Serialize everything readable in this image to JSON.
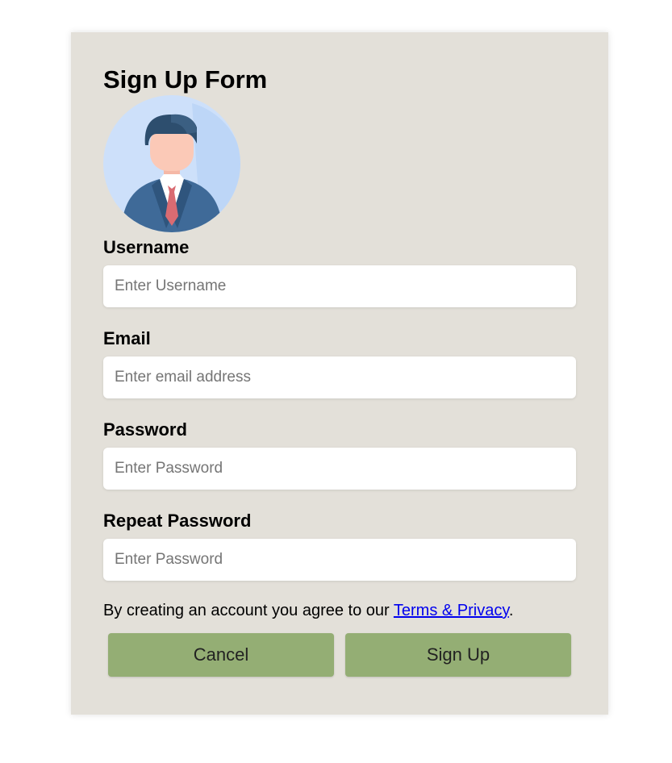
{
  "form": {
    "title": "Sign Up Form",
    "avatar_icon": "user-avatar-icon",
    "fields": [
      {
        "label": "Username",
        "placeholder": "Enter Username",
        "value": ""
      },
      {
        "label": "Email",
        "placeholder": "Enter email address",
        "value": ""
      },
      {
        "label": "Password",
        "placeholder": "Enter Password",
        "value": ""
      },
      {
        "label": "Repeat Password",
        "placeholder": "Enter Password",
        "value": ""
      }
    ],
    "terms_prefix": "By creating an account you agree to our ",
    "terms_link": "Terms & Privacy",
    "terms_suffix": ".",
    "cancel_label": "Cancel",
    "signup_label": "Sign Up"
  },
  "colors": {
    "card_background": "#e3e0d9",
    "button_background": "#94ae74",
    "link": "#0000ee"
  }
}
